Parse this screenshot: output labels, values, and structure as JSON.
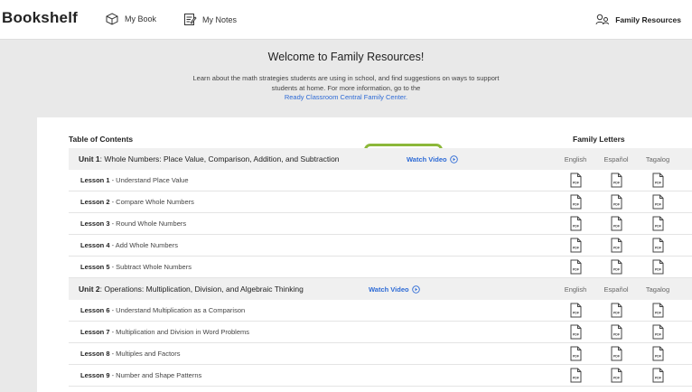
{
  "topbar": {
    "brand": "Bookshelf",
    "my_book": "My Book",
    "my_notes": "My Notes",
    "family_resources": "Family Resources"
  },
  "welcome": {
    "title": "Welcome to Family Resources!",
    "text": "Learn about the math strategies students are using in school, and find suggestions on ways to support students at home. For more information, go to the",
    "link": "Ready Classroom Central Family Center."
  },
  "toc": {
    "header": "Table of Contents",
    "family_letters_header": "Family Letters",
    "languages": [
      "English",
      "Español",
      "Tagalog"
    ],
    "watch_video": "Watch Video",
    "pdf_label": "PDF",
    "units": [
      {
        "prefix": "Unit 1",
        "title": ": Whole Numbers: Place Value, Comparison, Addition, and Subtraction",
        "lessons": [
          {
            "prefix": "Lesson 1",
            "title": " - Understand Place Value"
          },
          {
            "prefix": "Lesson 2",
            "title": " - Compare Whole Numbers"
          },
          {
            "prefix": "Lesson 3",
            "title": " - Round Whole Numbers"
          },
          {
            "prefix": "Lesson 4",
            "title": " - Add Whole Numbers"
          },
          {
            "prefix": "Lesson 5",
            "title": " - Subtract Whole Numbers"
          }
        ]
      },
      {
        "prefix": "Unit 2",
        "title": ": Operations: Multiplication, Division, and Algebraic Thinking",
        "lessons": [
          {
            "prefix": "Lesson 6",
            "title": " - Understand Multiplication as a Comparison"
          },
          {
            "prefix": "Lesson 7",
            "title": " - Multiplication and Division in Word Problems"
          },
          {
            "prefix": "Lesson 8",
            "title": " - Multiples and Factors"
          },
          {
            "prefix": "Lesson 9",
            "title": " - Number and Shape Patterns"
          }
        ]
      }
    ]
  },
  "colors": {
    "link": "#2e6bd6",
    "highlight": "#8cb83a",
    "unit_row_bg": "#f0f0f0"
  }
}
